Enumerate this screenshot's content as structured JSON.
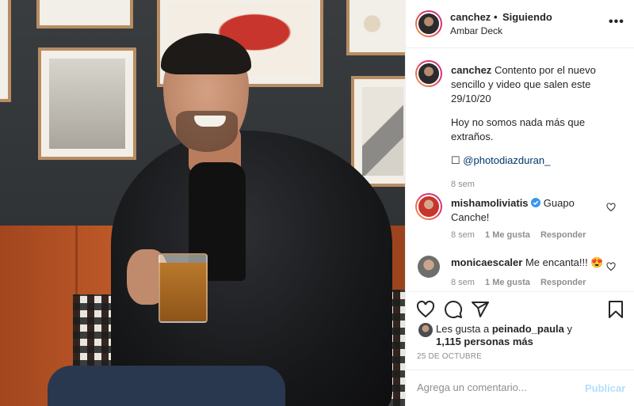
{
  "post": {
    "image_alt": "Man in black leather jacket holding a beer mug",
    "author": {
      "username": "canchez",
      "separator": "•",
      "follow_status": "Siguiendo",
      "location": "Ambar Deck",
      "more_icon": "•••"
    },
    "caption": {
      "username": "canchez",
      "text_1": "Contento por el nuevo sencillo y video que salen este 29/10/20",
      "text_2": "Hoy no somos nada más que extraños.",
      "mention_prefix": "☐",
      "mention": "@photodiazduran_",
      "time": "8 sem"
    },
    "comments": [
      {
        "username": "mishamoliviatis",
        "verified": true,
        "text": "Guapo Canche!",
        "time": "8 sem",
        "likes": "1 Me gusta",
        "reply": "Responder"
      },
      {
        "username": "monicaescaler",
        "verified": false,
        "text": "Me encanta!!! 😍",
        "time": "8 sem",
        "likes": "1 Me gusta",
        "reply": "Responder"
      }
    ],
    "likes": {
      "prefix": "Les gusta a",
      "user": "peinado_paula",
      "conj": "y",
      "others": "1,115 personas más"
    },
    "date": "25 DE OCTUBRE",
    "add_comment": {
      "placeholder": "Agrega un comentario...",
      "publish": "Publicar"
    },
    "icons": [
      "heart-icon",
      "comment-icon",
      "share-icon",
      "bookmark-icon",
      "more-icon",
      "verified-icon"
    ],
    "colors": {
      "link": "#00376b",
      "publish_disabled": "#b2dffc",
      "muted": "#8e8e8e",
      "verified": "#3897f0"
    }
  }
}
